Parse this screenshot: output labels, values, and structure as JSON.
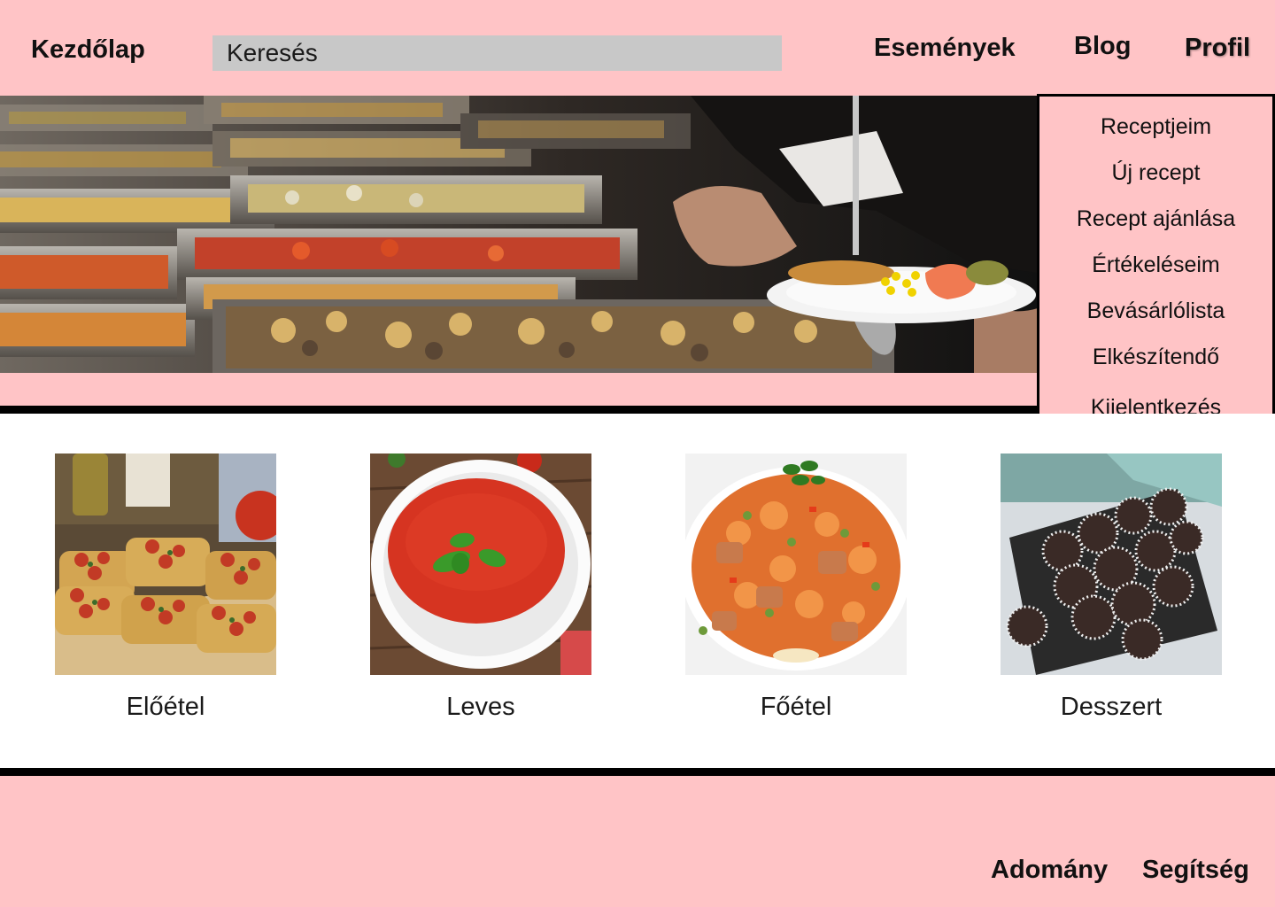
{
  "header": {
    "home_label": "Kezdőlap",
    "search_placeholder": "Keresés",
    "nav": {
      "events": "Események",
      "blog": "Blog",
      "profile": "Profil"
    }
  },
  "profile_menu": {
    "items": [
      "Receptjeim",
      "Új recept",
      "Recept ajánlása",
      "Értékeléseim",
      "Bevásárlólista",
      "Elkészítendő",
      "Kijelentkezés"
    ]
  },
  "hero": {
    "image": "buffet-serving-photo"
  },
  "categories": [
    {
      "label": "Előétel",
      "image": "bruschetta-photo"
    },
    {
      "label": "Leves",
      "image": "tomato-soup-photo"
    },
    {
      "label": "Főétel",
      "image": "rice-pilaf-photo"
    },
    {
      "label": "Desszert",
      "image": "coconut-balls-photo"
    }
  ],
  "footer": {
    "donate": "Adomány",
    "help": "Segítség"
  },
  "colors": {
    "background": "#ffc4c6",
    "search_bg": "#c8c8c8",
    "divider": "#000000",
    "content_bg": "#ffffff"
  }
}
